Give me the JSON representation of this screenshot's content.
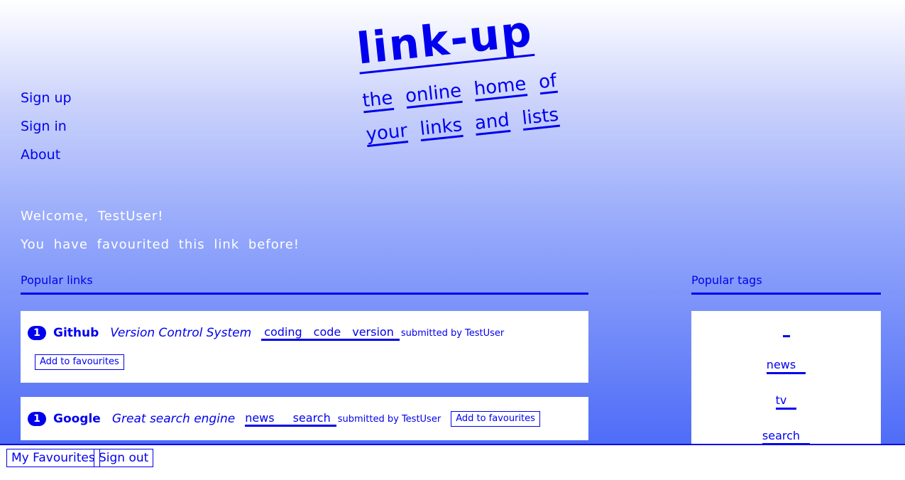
{
  "logo": {
    "title": "link-up",
    "tagline_words": [
      "the",
      "online",
      "home",
      "of",
      "your",
      "links",
      "and",
      "lists"
    ]
  },
  "nav": {
    "sign_up": "Sign up",
    "sign_in": "Sign in",
    "about": "About"
  },
  "messages": {
    "welcome": "Welcome, TestUser!",
    "notice": "You have favourited this link before!"
  },
  "popular_links": {
    "header": "Popular links",
    "items": [
      {
        "rank": "1",
        "title": "Github",
        "description": "Version Control System",
        "tags": [
          "coding",
          "code",
          "version"
        ],
        "submitted": "submitted by TestUser",
        "button": "Add to favourites"
      },
      {
        "rank": "1",
        "title": "Google",
        "description": "Great search engine",
        "tags": [
          "news",
          "search"
        ],
        "submitted": "submitted by TestUser",
        "button": "Add to favourites"
      }
    ]
  },
  "popular_tags": {
    "header": "Popular tags",
    "items": [
      "",
      "news",
      "tv",
      "search"
    ]
  },
  "bottom": {
    "favourites": "My Favourites",
    "sign_out": "Sign out"
  },
  "colors": {
    "accent": "#0000ee",
    "gradient_top": "#ffffff",
    "gradient_bottom": "#4f6cf7"
  }
}
